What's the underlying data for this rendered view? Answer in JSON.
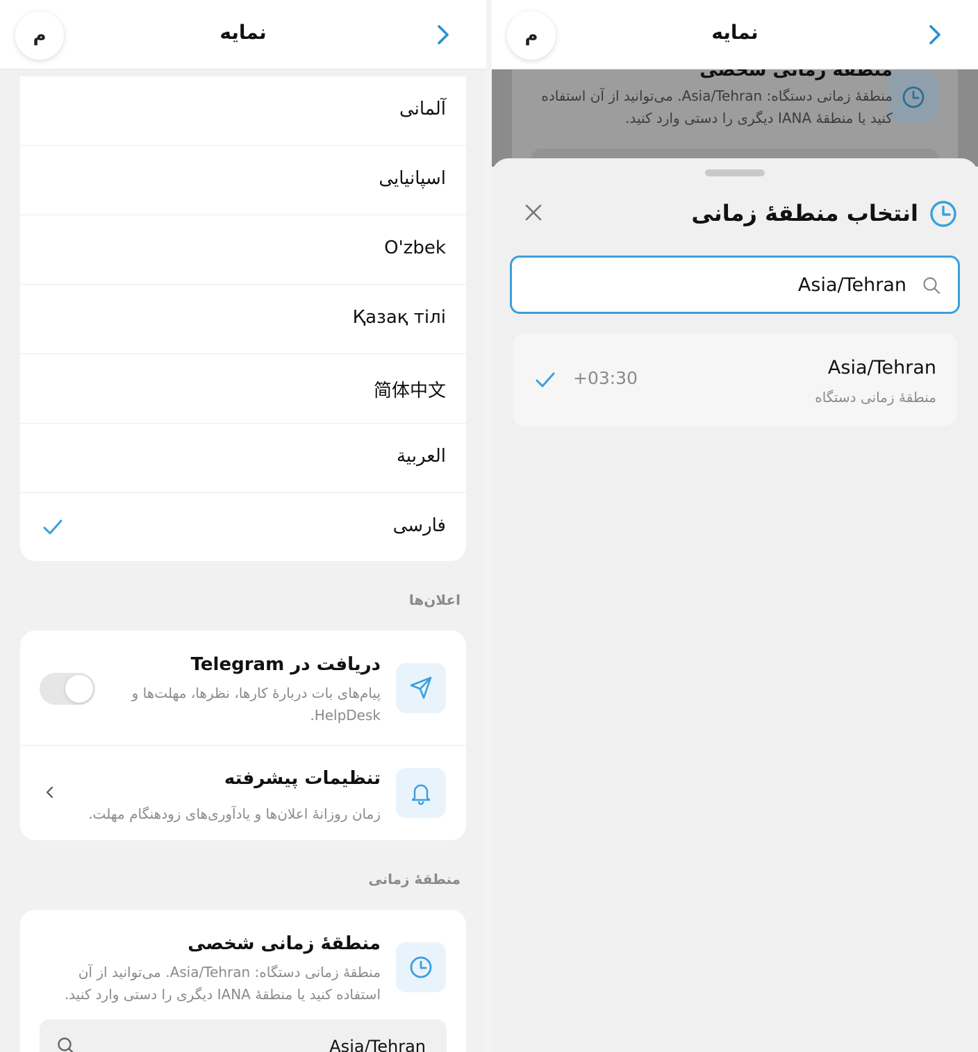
{
  "colors": {
    "accent": "#3a9fdc",
    "background": "#f1f1f1",
    "card": "#ffffff",
    "muted_text": "#8a8a8a"
  },
  "left": {
    "header": {
      "avatar_letter": "م",
      "title": "نمایه",
      "nav_icon": "chevron-right-icon"
    },
    "languages": [
      {
        "label": "آلمانی"
      },
      {
        "label": "اسپانیایی"
      },
      {
        "label": "O'zbek"
      },
      {
        "label": "Қазақ тілі"
      },
      {
        "label": "简体中文"
      },
      {
        "label": "العربية"
      },
      {
        "label": "فارسی",
        "selected": true
      }
    ],
    "notifications": {
      "section_label": "اعلان‌ها",
      "telegram": {
        "title": "دریافت در Telegram",
        "description": "پیام‌های بات دربارهٔ کارها، نظرها، مهلت‌ها و HelpDesk.",
        "toggle_on": false,
        "icon": "send-icon"
      },
      "advanced": {
        "title": "تنظیمات پیشرفته",
        "description": "زمان روزانهٔ اعلان‌ها و یادآوری‌های زودهنگام مهلت.",
        "icon": "bell-icon"
      }
    },
    "timezone": {
      "section_label": "منطقهٔ زمانی",
      "title": "منطقهٔ زمانی شخصی",
      "description": "منطقهٔ زمانی دستگاه: Asia/Tehran. می‌توانید از آن استفاده کنید یا منطقهٔ IANA دیگری را دستی وارد کنید.",
      "input_value": "Asia/Tehran",
      "icon": "clock-icon"
    }
  },
  "right": {
    "header": {
      "avatar_letter": "م",
      "title": "نمایه",
      "nav_icon": "chevron-right-icon"
    },
    "background_card": {
      "title": "منطقهٔ زمانی شخصی",
      "description": "منطقهٔ زمانی دستگاه: Asia/Tehran. می‌توانید از آن استفاده کنید یا منطقهٔ IANA دیگری را دستی وارد کنید."
    },
    "sheet": {
      "title": "انتخاب منطقهٔ زمانی",
      "search_value": "Asia/Tehran",
      "results": [
        {
          "name": "Asia/Tehran",
          "subtitle": "منطقهٔ زمانی دستگاه",
          "offset": "+03:30",
          "selected": true
        }
      ]
    }
  }
}
